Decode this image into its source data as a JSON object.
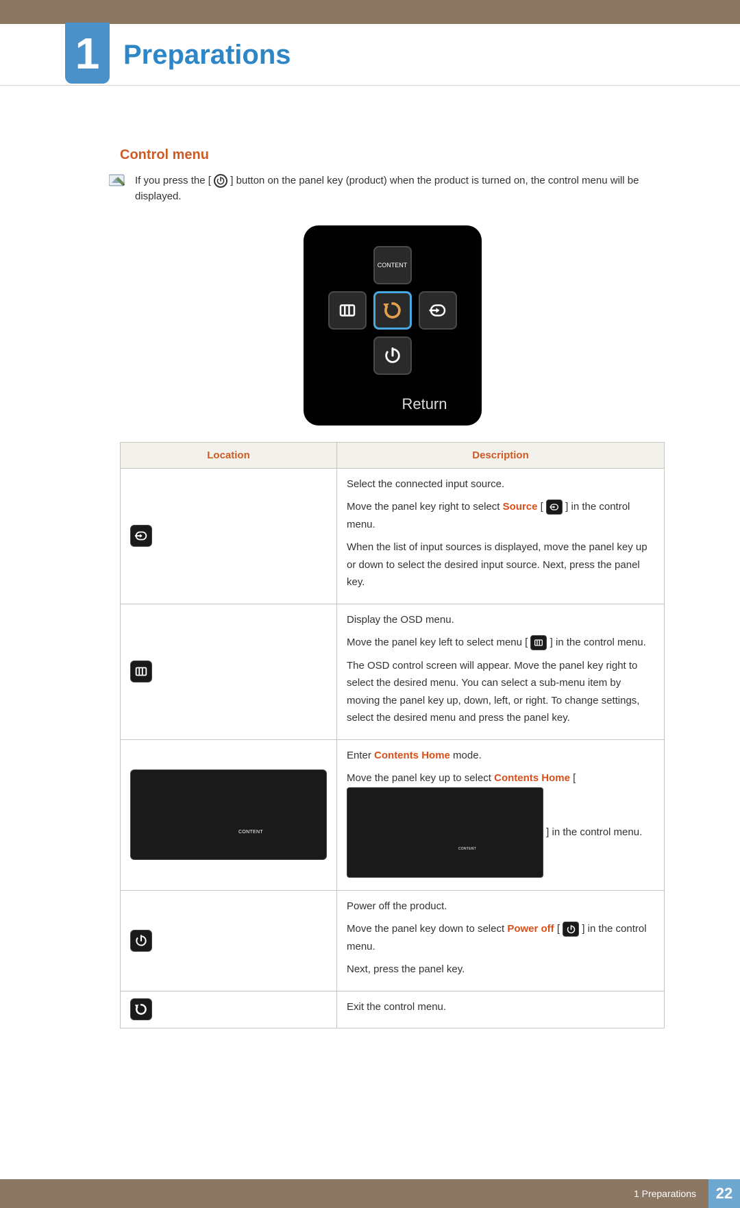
{
  "chapter": {
    "num": "1",
    "title": "Preparations"
  },
  "section": "Control menu",
  "note": {
    "p1": "If you press the [",
    "p2": "] button on the panel key (product) when the product is turned on, the control menu will be displayed."
  },
  "panel": {
    "content": "CONTENT",
    "returnLabel": "Return"
  },
  "table": {
    "hLoc": "Location",
    "hDesc": "Description",
    "rows": {
      "source": {
        "l1": "Select the connected input source.",
        "l2a": "Move the panel key right to select ",
        "l2kw": "Source",
        "l2b": " [",
        "l2c": "] in the control menu.",
        "l3": "When the list of input sources is displayed, move the panel key up or down to select the desired input source. Next, press the panel key."
      },
      "osd": {
        "l1": "Display the OSD menu.",
        "l2a": "Move the panel key left to select menu [",
        "l2b": "] in the control menu.",
        "l3": "The OSD control screen will appear. Move the panel key right to select the desired menu. You can select a sub-menu item by moving the panel key up, down, left, or right. To change settings, select the desired menu and press the panel key."
      },
      "content": {
        "l1a": "Enter ",
        "l1kw": "Contents Home",
        "l1b": " mode.",
        "l2a": "Move the panel key up to select ",
        "l2kw": "Contents Home",
        "l2b": " [",
        "l2c": "] in the control menu.",
        "tag": "CONTENT"
      },
      "power": {
        "l1": "Power off the product.",
        "l2a": "Move the panel key down to select ",
        "l2kw": "Power off",
        "l2b": " [",
        "l2c": "] in the control menu.",
        "l3": "Next, press the panel key."
      },
      "return": {
        "l1": "Exit the control menu."
      }
    }
  },
  "footer": {
    "label": "1 Preparations",
    "page": "22"
  }
}
